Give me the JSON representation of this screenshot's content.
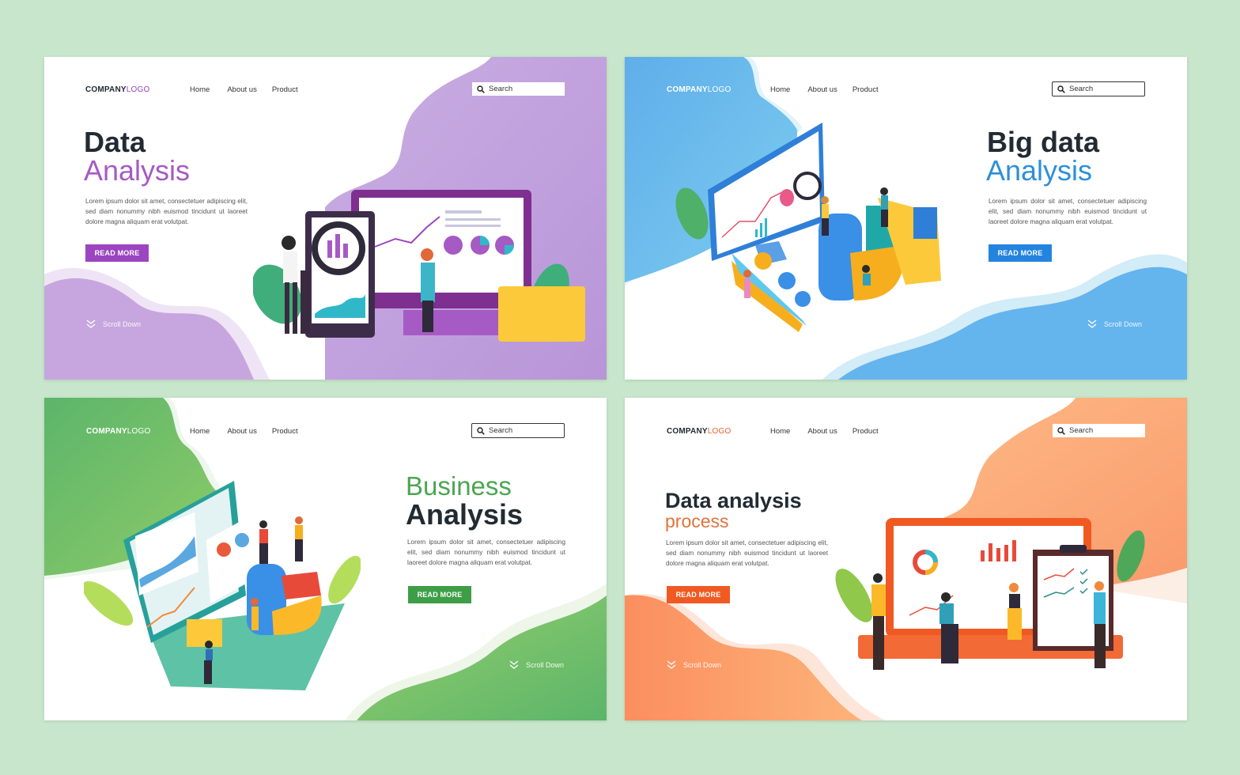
{
  "colors": {
    "page_bg": "#c8e6cb",
    "purple": "#9c45c0",
    "purple_bg": "#c4a3de",
    "blue": "#2384e0",
    "blue_bg": "#6bbbee",
    "green": "#3e9e47",
    "green_bg": "#6dbd69",
    "orange": "#f05a22",
    "orange_bg": "#fba878",
    "dark_text": "#222b33"
  },
  "panels": [
    {
      "id": "data-analysis",
      "logo": {
        "bold": "COMPANY",
        "light": "LOGO"
      },
      "nav": [
        "Home",
        "About us",
        "Product"
      ],
      "search": {
        "placeholder": "Search",
        "icon": "search-icon"
      },
      "title": {
        "bold": "Data",
        "light": "Analysis"
      },
      "description": "Lorem ipsum dolor sit amet, consectetuer adipiscing elit, sed diam nonummy nibh euismod tincidunt ut laoreet dolore magna aliquam erat volutpat.",
      "button": "READ MORE",
      "scroll": {
        "label": "Scroll Down",
        "icon": "double-chevron-down-icon"
      }
    },
    {
      "id": "big-data-analysis",
      "logo": {
        "bold": "COMPANY",
        "light": "LOGO"
      },
      "nav": [
        "Home",
        "About us",
        "Product"
      ],
      "search": {
        "placeholder": "Search",
        "icon": "search-icon"
      },
      "title": {
        "bold": "Big data",
        "light": "Analysis"
      },
      "description": "Lorem ipsum dolor sit amet, consectetuer adipiscing elit, sed diam nonummy nibh euismod tincidunt ut laoreet dolore magna aliquam erat volutpat.",
      "button": "READ MORE",
      "scroll": {
        "label": "Scroll Down",
        "icon": "double-chevron-down-icon"
      }
    },
    {
      "id": "business-analysis",
      "logo": {
        "bold": "COMPANY",
        "light": "LOGO"
      },
      "nav": [
        "Home",
        "About us",
        "Product"
      ],
      "search": {
        "placeholder": "Search",
        "icon": "search-icon"
      },
      "title": {
        "light": "Business",
        "bold": "Analysis"
      },
      "description": "Lorem ipsum dolor sit amet, consectetuer adipiscing elit, sed diam nonummy nibh euismod tincidunt ut laoreet dolore magna aliquam erat volutpat.",
      "button": "READ MORE",
      "scroll": {
        "label": "Scroll Down",
        "icon": "double-chevron-down-icon"
      }
    },
    {
      "id": "data-analysis-process",
      "logo": {
        "bold": "COMPANY",
        "light": "LOGO"
      },
      "nav": [
        "Home",
        "About us",
        "Product"
      ],
      "search": {
        "placeholder": "Search",
        "icon": "search-icon"
      },
      "title": {
        "bold": "Data analysis",
        "light": "process"
      },
      "description": "Lorem ipsum dolor sit amet, consectetuer adipiscing elit, sed diam nonummy nibh euismod tincidunt ut laoreet dolore magna aliquam erat volutpat.",
      "button": "READ MORE",
      "scroll": {
        "label": "Scroll Down",
        "icon": "double-chevron-down-icon"
      }
    }
  ]
}
